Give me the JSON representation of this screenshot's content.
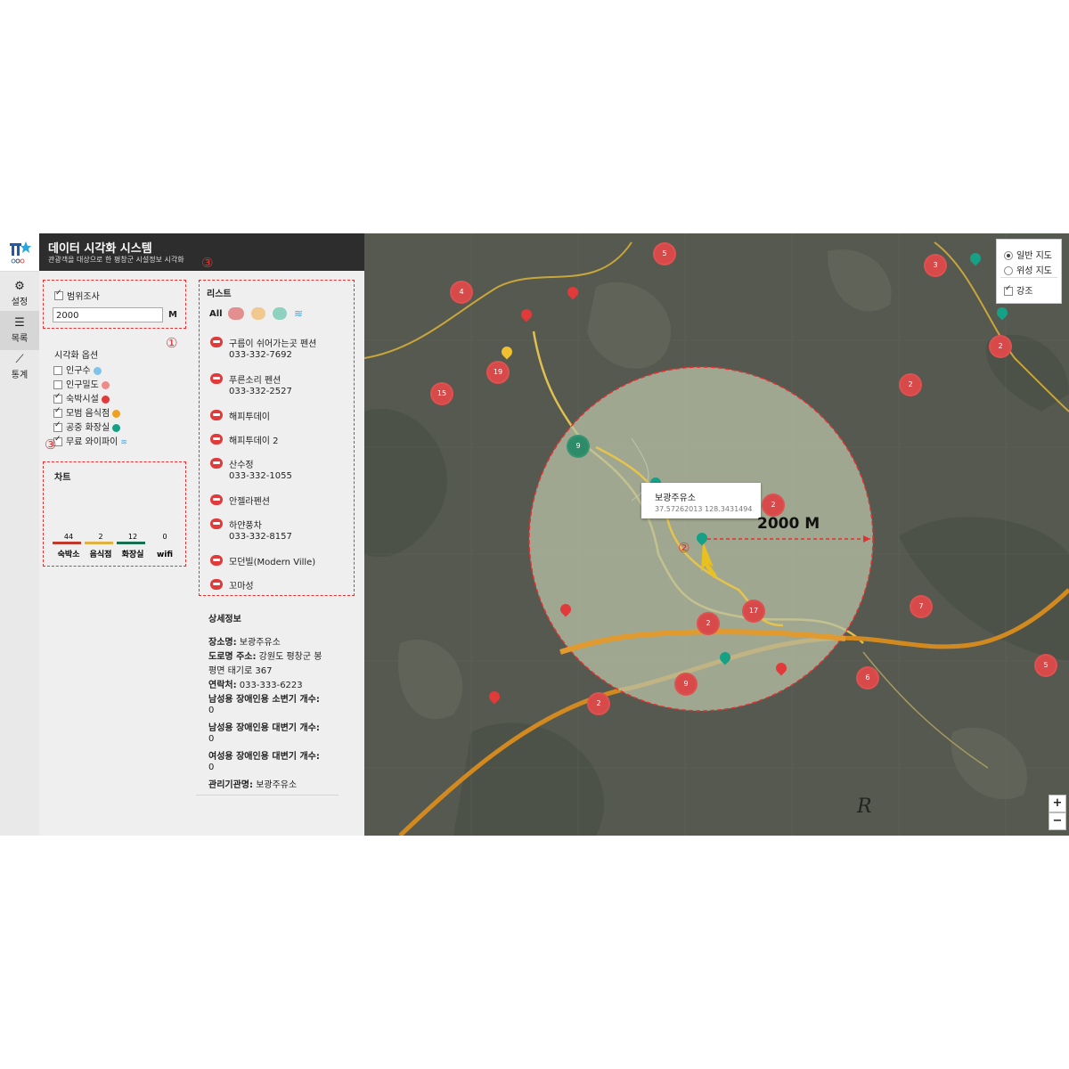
{
  "app": {
    "title": "데이터 시각화 시스템",
    "subtitle": "관광객을 대상으로 한 평창군 시설정보 시각화"
  },
  "rail": {
    "items": [
      {
        "label": "설정",
        "icon": "gear-icon"
      },
      {
        "label": "목록",
        "icon": "list-icon"
      },
      {
        "label": "통계",
        "icon": "chart-icon"
      }
    ]
  },
  "range": {
    "label": "범위조사",
    "checked": true,
    "value": "2000",
    "unit": "M"
  },
  "viz": {
    "title": "시각화 옵션",
    "options": [
      {
        "label": "인구수",
        "checked": false,
        "color": "#4aa8e0"
      },
      {
        "label": "인구밀도",
        "checked": false,
        "color": "#e66a6a"
      },
      {
        "label": "숙박시설",
        "checked": true,
        "color": "#e03a3a"
      },
      {
        "label": "모범 음식점",
        "checked": true,
        "color": "#f0a020"
      },
      {
        "label": "공중 화장실",
        "checked": true,
        "color": "#16a085"
      },
      {
        "label": "무료 와이파이",
        "checked": true,
        "color": "#4aa8e0"
      }
    ]
  },
  "chart": {
    "title": "차트"
  },
  "chart_data": {
    "type": "bar",
    "categories": [
      "숙박소",
      "음식점",
      "화장실",
      "wifi"
    ],
    "values": [
      44,
      2,
      12,
      0
    ],
    "colors": [
      "#c0392b",
      "#e0b040",
      "#16704f",
      "#999999"
    ]
  },
  "annotations": {
    "n1": "①",
    "n2": "②",
    "n3a": "③",
    "n3b": "③"
  },
  "list": {
    "title": "리스트",
    "filter_all": "All",
    "items": [
      {
        "name": "구름이 쉬어가는곳 펜션",
        "phone": "033-332-7692"
      },
      {
        "name": "푸른소리 펜션",
        "phone": "033-332-2527"
      },
      {
        "name": "해피투데이",
        "phone": ""
      },
      {
        "name": "해피투데이 2",
        "phone": ""
      },
      {
        "name": "산수정",
        "phone": "033-332-1055"
      },
      {
        "name": "안젤라펜션",
        "phone": ""
      },
      {
        "name": "하얀풍차",
        "phone": "033-332-8157"
      },
      {
        "name": "모던빌(Modern Ville)",
        "phone": ""
      },
      {
        "name": "꼬마성",
        "phone": ""
      }
    ]
  },
  "detail": {
    "title": "상세정보",
    "place_label": "장소명:",
    "place": "보광주유소",
    "road_label": "도로명 주소:",
    "road1": "강원도 평창군 봉",
    "road2": "평면 태기로 367",
    "contact_label": "연락처:",
    "contact": "033-333-6223",
    "m_urinal_label": "남성용 장애인용 소변기 개수:",
    "m_urinal": "0",
    "m_toilet_label": "남성용 장애인용 대변기 개수:",
    "m_toilet": "0",
    "f_toilet_label": "여성용 장애인용 대변기 개수:",
    "f_toilet": "0",
    "agency_label": "관리기관명:",
    "agency": "보광주유소"
  },
  "map": {
    "layers": [
      {
        "label": "일반 지도",
        "selected": true
      },
      {
        "label": "위성 지도",
        "selected": false
      }
    ],
    "highlight_label": "강조",
    "popup_name": "보광주유소",
    "popup_coords": "37.57262013 128.3431494",
    "radius_label": "2000 M",
    "zoom_in": "+",
    "zoom_out": "−",
    "watermark": "R",
    "clusters": [
      "5",
      "3",
      "4",
      "2",
      "19",
      "15",
      "2",
      "2",
      "17",
      "7",
      "2",
      "9",
      "2",
      "6",
      "5"
    ],
    "green_cluster": "9"
  }
}
